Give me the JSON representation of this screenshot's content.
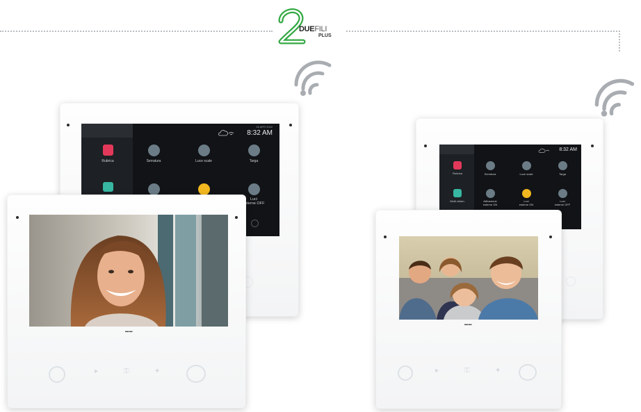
{
  "logo": {
    "numeral": "2",
    "word_bold": "DUE",
    "word_thin": "FILI",
    "plus": "PLUS",
    "green": "#33a843"
  },
  "left_back_monitor": {
    "date": "26 APR 2022",
    "time": "8:32 AM",
    "tiles": [
      {
        "label": "Rubrica",
        "icon": "address-book-icon"
      },
      {
        "label": "Serratura",
        "icon": "key-icon"
      },
      {
        "label": "Luce scale",
        "icon": "lamp-icon"
      },
      {
        "label": "Targa",
        "icon": "intercom-icon"
      },
      {
        "label": "",
        "icon": "video-memory-icon"
      },
      {
        "label": "",
        "icon": "camera-icon"
      },
      {
        "label": "",
        "icon": "light-bulb-icon"
      },
      {
        "label": "Luci\nesterne OFF",
        "icon": "external-lights-icon"
      }
    ]
  },
  "right_back_monitor": {
    "time": "8:32 AM",
    "tiles": [
      {
        "label": "Rubrica",
        "icon": "address-book-icon"
      },
      {
        "label": "Serratura",
        "icon": "key-icon"
      },
      {
        "label": "Luce scale",
        "icon": "lamp-icon"
      },
      {
        "label": "Targa",
        "icon": "intercom-icon"
      },
      {
        "label": "Multi chiam.",
        "icon": "video-memory-icon"
      },
      {
        "label": "Attivazione\nesterne ON",
        "icon": "camera-icon"
      },
      {
        "label": "Luci\nesterne ON",
        "icon": "light-bulb-icon"
      },
      {
        "label": "Luci\nesterne OFF",
        "icon": "external-lights-icon"
      }
    ]
  },
  "colors": {
    "screen_bg": "#111316",
    "accent_red": "#e2395a",
    "accent_teal": "#37b6a1",
    "accent_yellow": "#f2b81f"
  }
}
